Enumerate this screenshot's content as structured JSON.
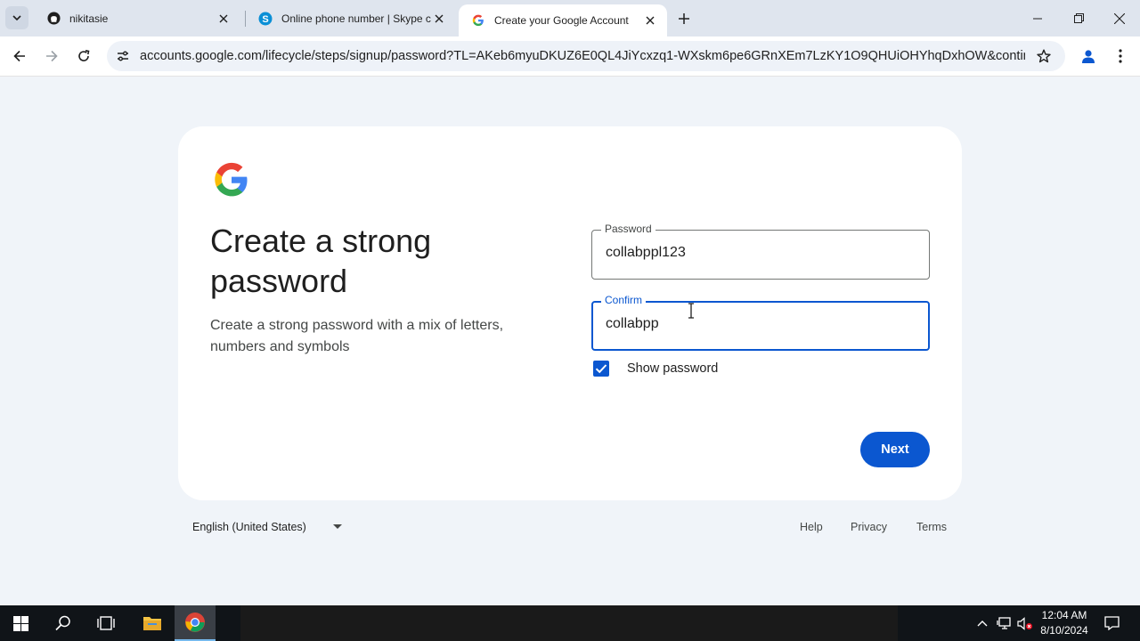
{
  "browser": {
    "tabs": [
      {
        "title": "nikitasie",
        "icon": "github-icon"
      },
      {
        "title": "Online phone number | Skype c",
        "icon": "skype-icon"
      },
      {
        "title": "Create your Google Account",
        "icon": "google-icon",
        "active": true
      }
    ],
    "url": "accounts.google.com/lifecycle/steps/signup/password?TL=AKeb6myuDKUZ6E0QL4JiYcxzq1-WXskm6pe6GRnXEm7LzKY1O9QHUiOHYhqDxhOW&continue=htt..."
  },
  "page": {
    "heading": "Create a strong password",
    "subtext": "Create a strong password with a mix of letters, numbers and symbols",
    "password_label": "Password",
    "password_value": "collabppl123",
    "confirm_label": "Confirm",
    "confirm_value": "collabpp",
    "show_password_label": "Show password",
    "show_password_checked": true,
    "next_label": "Next"
  },
  "footer": {
    "language": "English (United States)",
    "links": [
      "Help",
      "Privacy",
      "Terms"
    ]
  },
  "taskbar": {
    "time": "12:04 AM",
    "date": "8/10/2024"
  },
  "colors": {
    "accent": "#0b57d0",
    "page_bg": "#f0f4f9"
  }
}
